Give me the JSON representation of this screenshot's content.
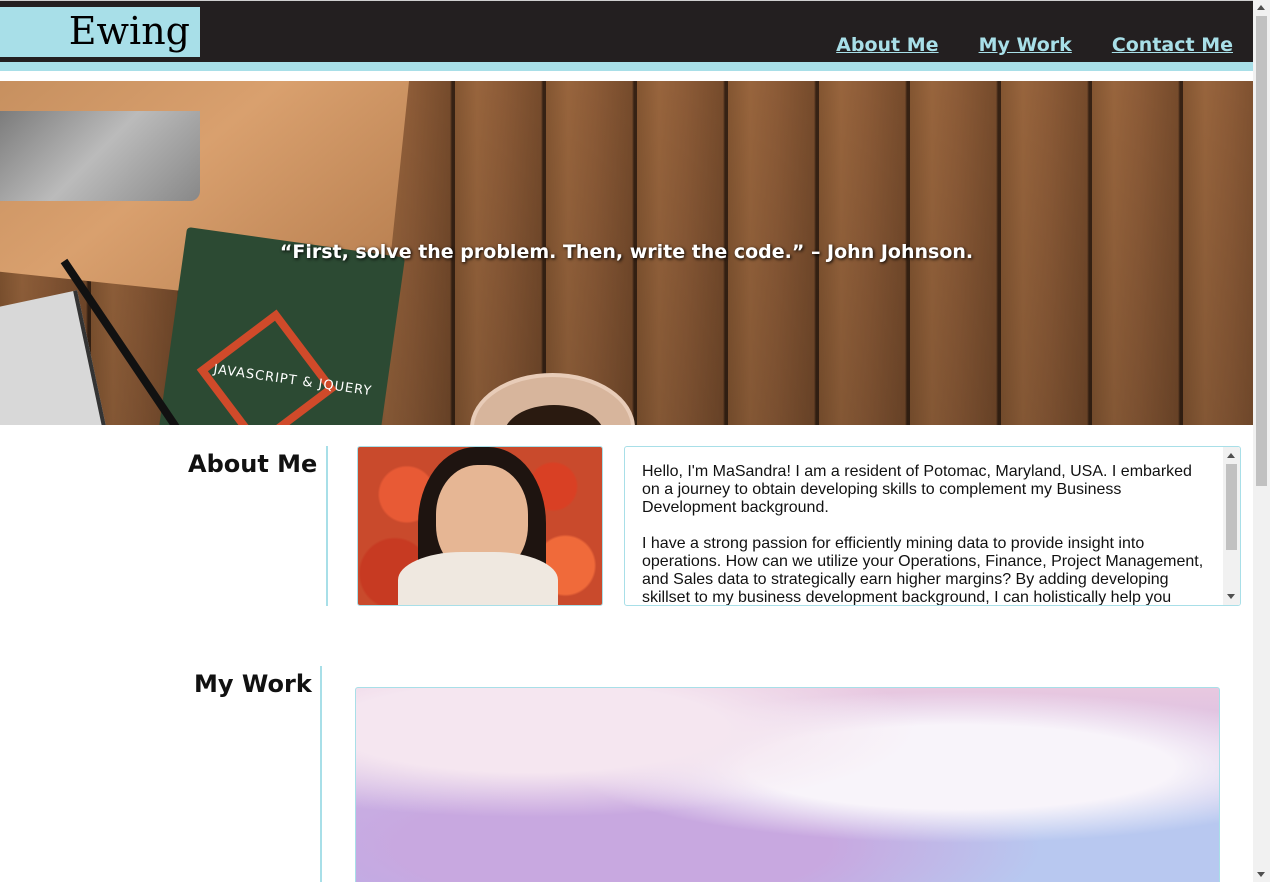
{
  "header": {
    "logo": "Ewing",
    "nav": [
      {
        "label": "About Me"
      },
      {
        "label": "My Work"
      },
      {
        "label": "Contact Me"
      }
    ]
  },
  "hero": {
    "quote": "“First, solve the problem. Then, write the code.” – John Johnson.",
    "book_title": "JAVASCRIPT & JQUERY"
  },
  "about": {
    "title": "About Me",
    "paragraphs": [
      "Hello, I'm MaSandra! I am a resident of Potomac, Maryland, USA. I embarked on a journey to obtain developing skills to complement my Business Development background.",
      "I have a strong passion for efficiently mining data to provide insight into operations. How can we utilize your Operations, Finance, Project Management, and Sales data to strategically earn higher margins? By adding developing skillset to my business development background, I can holistically help you"
    ]
  },
  "work": {
    "title": "My Work"
  },
  "colors": {
    "accent": "#a8dfe8",
    "header_bg": "#231f20"
  }
}
